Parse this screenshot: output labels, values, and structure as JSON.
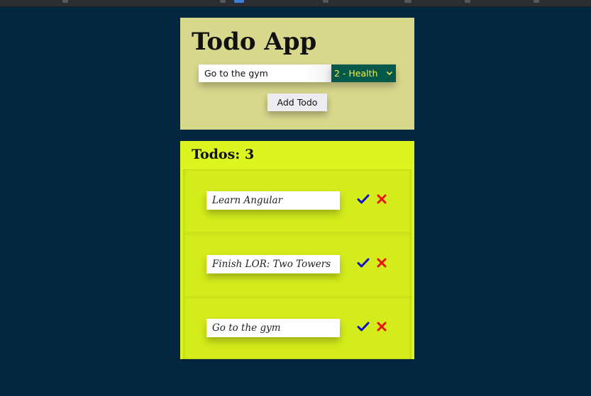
{
  "header": {
    "title": "Todo App",
    "input_value": "Go to the gym",
    "category_selected": "2 - Health",
    "add_button_label": "Add Todo"
  },
  "list": {
    "heading_label": "Todos:",
    "count": "3",
    "items": [
      {
        "text": "Learn Angular"
      },
      {
        "text": "Finish LOR: Two Towers"
      },
      {
        "text": "Go to the gym"
      }
    ]
  },
  "colors": {
    "page_background": "#03273f",
    "header_card": "#d8d88d",
    "list_card": "#dcf520",
    "select_background": "#06594a",
    "select_text": "#f4f04a",
    "check_icon": "#1010c8",
    "delete_icon": "#ee1010"
  },
  "icons": {
    "complete": "check-icon",
    "remove": "close-icon",
    "select_arrow": "chevron-down-icon"
  }
}
